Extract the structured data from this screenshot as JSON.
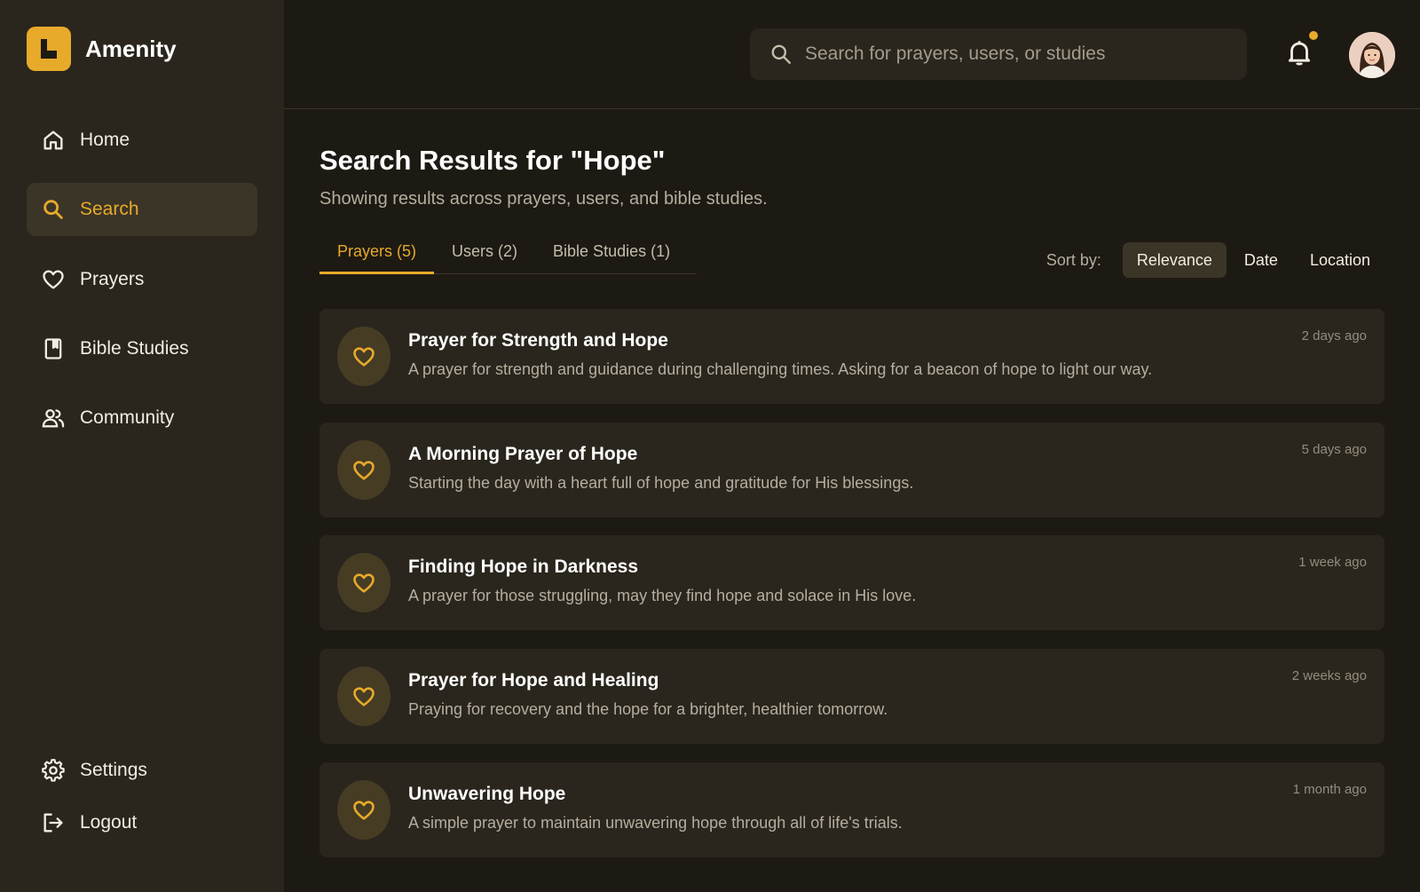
{
  "brand": {
    "name": "Amenity"
  },
  "sidebar": {
    "items": [
      {
        "label": "Home",
        "icon": "home-icon"
      },
      {
        "label": "Search",
        "icon": "search-icon",
        "active": true
      },
      {
        "label": "Prayers",
        "icon": "heart-icon"
      },
      {
        "label": "Bible Studies",
        "icon": "book-icon"
      },
      {
        "label": "Community",
        "icon": "users-icon"
      }
    ],
    "bottom": [
      {
        "label": "Settings",
        "icon": "gear-icon"
      },
      {
        "label": "Logout",
        "icon": "logout-icon"
      }
    ]
  },
  "header": {
    "search_placeholder": "Search for prayers, users, or studies",
    "notifications_unread": true
  },
  "main": {
    "title": "Search Results for \"Hope\"",
    "subtitle": "Showing results across prayers, users, and bible studies.",
    "tabs": [
      {
        "label": "Prayers (5)",
        "active": true
      },
      {
        "label": "Users (2)"
      },
      {
        "label": "Bible Studies (1)"
      }
    ],
    "sort": {
      "label": "Sort by:",
      "options": [
        "Relevance",
        "Date",
        "Location"
      ],
      "selected": "Relevance"
    },
    "results": [
      {
        "title": "Prayer for Strength and Hope",
        "description": "A prayer for strength and guidance during challenging times. Asking for a beacon of hope to light our way.",
        "time": "2 days ago"
      },
      {
        "title": "A Morning Prayer of Hope",
        "description": "Starting the day with a heart full of hope and gratitude for His blessings.",
        "time": "5 days ago"
      },
      {
        "title": "Finding Hope in Darkness",
        "description": "A prayer for those struggling, may they find hope and solace in His love.",
        "time": "1 week ago"
      },
      {
        "title": "Prayer for Hope and Healing",
        "description": "Praying for recovery and the hope for a brighter, healthier tomorrow.",
        "time": "2 weeks ago"
      },
      {
        "title": "Unwavering Hope",
        "description": "A simple prayer to maintain unwavering hope through all of life's trials.",
        "time": "1 month ago"
      }
    ]
  },
  "colors": {
    "accent": "#e8aa2a",
    "sidebar_bg": "#2a261d",
    "page_bg": "#1d1a13",
    "card_bg": "#2a261d"
  }
}
